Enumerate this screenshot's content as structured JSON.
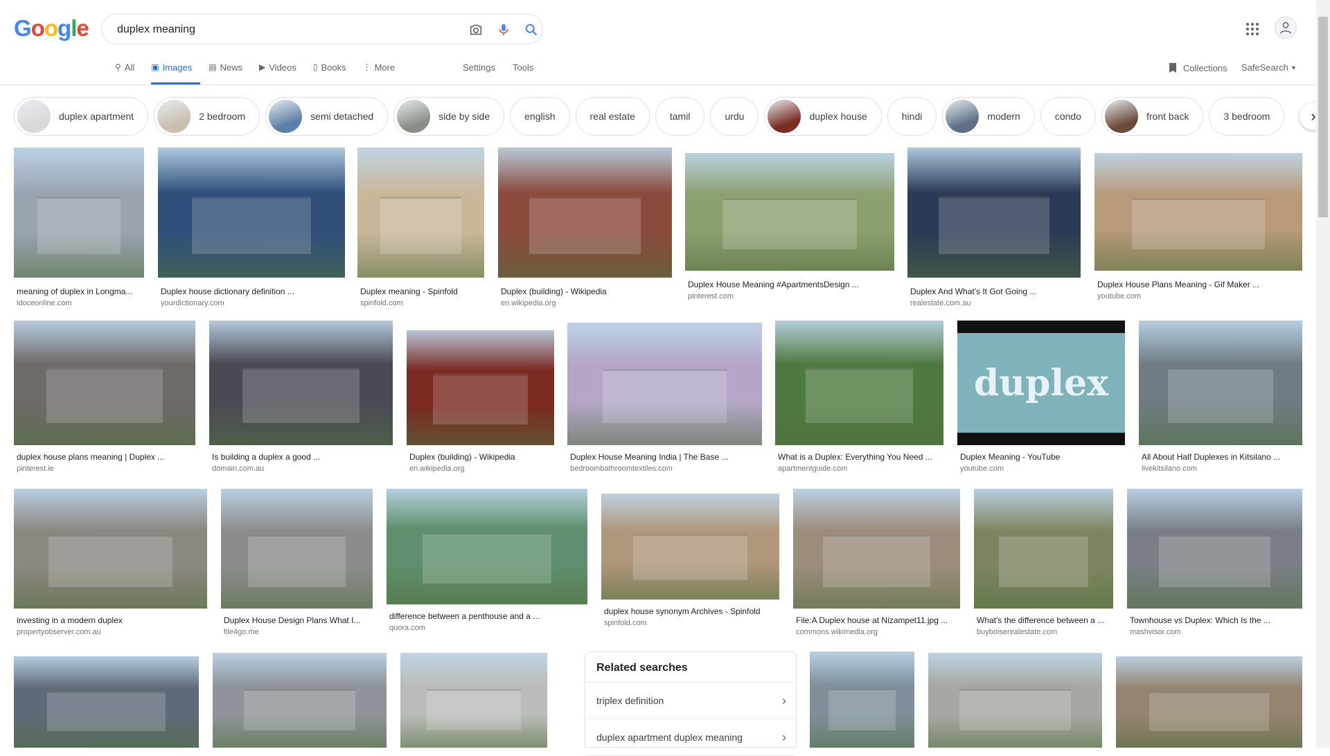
{
  "logo": {
    "letters": [
      "G",
      "o",
      "o",
      "g",
      "l",
      "e"
    ]
  },
  "search": {
    "value": "duplex meaning",
    "placeholder": "Search"
  },
  "tabs": [
    {
      "label": "All",
      "icon": "search-icon"
    },
    {
      "label": "Images",
      "icon": "image-icon"
    },
    {
      "label": "News",
      "icon": "news-icon"
    },
    {
      "label": "Videos",
      "icon": "video-icon"
    },
    {
      "label": "Books",
      "icon": "book-icon"
    },
    {
      "label": "More",
      "icon": "more-vert-icon"
    }
  ],
  "tools": {
    "settings": "Settings",
    "tools": "Tools"
  },
  "right_nav": {
    "collections": "Collections",
    "safesearch": "SafeSearch"
  },
  "chips": [
    {
      "label": "duplex apartment",
      "thumb": true,
      "color": "#d9d9d9"
    },
    {
      "label": "2 bedroom",
      "thumb": true,
      "color": "#c9bfae"
    },
    {
      "label": "semi detached",
      "thumb": true,
      "color": "#5a7fa8"
    },
    {
      "label": "side by side",
      "thumb": true,
      "color": "#8a8f86"
    },
    {
      "label": "english",
      "thumb": false
    },
    {
      "label": "real estate",
      "thumb": false
    },
    {
      "label": "tamil",
      "thumb": false
    },
    {
      "label": "urdu",
      "thumb": false
    },
    {
      "label": "duplex house",
      "thumb": true,
      "color": "#7a2b22"
    },
    {
      "label": "hindi",
      "thumb": false
    },
    {
      "label": "modern",
      "thumb": true,
      "color": "#5c6f86"
    },
    {
      "label": "condo",
      "thumb": false
    },
    {
      "label": "front back",
      "thumb": true,
      "color": "#6b4c3b"
    },
    {
      "label": "3 bedroom",
      "thumb": false
    }
  ],
  "results": [
    {
      "title": "meaning of duplex in Longma...",
      "source": "ldoceonline.com",
      "color": "#9aa3b0"
    },
    {
      "title": "Duplex house dictionary definition ...",
      "source": "yourdictionary.com",
      "color": "#2f4f7a"
    },
    {
      "title": "Duplex meaning - Spinfold",
      "source": "spinfold.com",
      "color": "#c9b79a"
    },
    {
      "title": "Duplex (building) - Wikipedia",
      "source": "en.wikipedia.org",
      "color": "#8b4a3c"
    },
    {
      "title": "Duplex House Meaning #ApartmentsDesign ...",
      "source": "pinterest.com",
      "color": "#8da070"
    },
    {
      "title": "Duplex And What's It Got Going ...",
      "source": "realestate.com.au",
      "color": "#2b3a56"
    },
    {
      "title": "Duplex House Plans Meaning - Gif Maker ...",
      "source": "youtube.com",
      "color": "#b89a7a"
    },
    {
      "title": "duplex house plans meaning | Duplex ...",
      "source": "pinterest.ie",
      "color": "#6e6a68"
    },
    {
      "title": "Is building a duplex a good ...",
      "source": "domain.com.au",
      "color": "#4a4a55"
    },
    {
      "title": "Duplex (building) - Wikipedia",
      "source": "en.wikipedia.org",
      "color": "#7b2a22"
    },
    {
      "title": "Duplex House Meaning India | The Base ...",
      "source": "bedroombathroomtextiles.com",
      "color": "#b4a6c8"
    },
    {
      "title": "What is a Duplex: Everything You Need ...",
      "source": "apartmentguide.com",
      "color": "#4f7a3f"
    },
    {
      "title": "Duplex Meaning - YouTube",
      "source": "youtube.com",
      "color": "#7fb3bb"
    },
    {
      "title": "All About Half Duplexes in Kitsilano ...",
      "source": "livekitsilano.com",
      "color": "#6f7c84"
    },
    {
      "title": "investing in a modern duplex",
      "source": "propertyobserver.com.au",
      "color": "#8c8780"
    },
    {
      "title": "Duplex House Design Plans What I...",
      "source": "file4go.me",
      "color": "#8c8c8c"
    },
    {
      "title": "difference between a penthouse and a ...",
      "source": "quora.com",
      "color": "#5f8f6e"
    },
    {
      "title": "duplex house synonym Archives - Spinfold",
      "source": "spinfold.com",
      "color": "#b0977c"
    },
    {
      "title": "File:A Duplex house at Nizampet11.jpg ...",
      "source": "commons.wikimedia.org",
      "color": "#9c8c7c"
    },
    {
      "title": "What's the difference between a ...",
      "source": "buyboiserealestate.com",
      "color": "#7d8560"
    },
    {
      "title": "Townhouse vs Duplex: Which Is the ...",
      "source": "mashvisor.com",
      "color": "#7a7f86"
    },
    {
      "title": "",
      "source": "",
      "color": "#5e6a78"
    },
    {
      "title": "",
      "source": "",
      "color": "#8f949a"
    },
    {
      "title": "",
      "source": "",
      "color": "#b9bcb8"
    },
    {
      "title": "",
      "source": "",
      "color": "#7f8f9c"
    },
    {
      "title": "",
      "source": "",
      "color": "#a8a8a2"
    },
    {
      "title": "",
      "source": "",
      "color": "#94836f"
    }
  ],
  "duplex_text": "duplex",
  "related": {
    "heading": "Related searches",
    "items": [
      "triplex definition",
      "duplex apartment duplex meaning"
    ]
  }
}
